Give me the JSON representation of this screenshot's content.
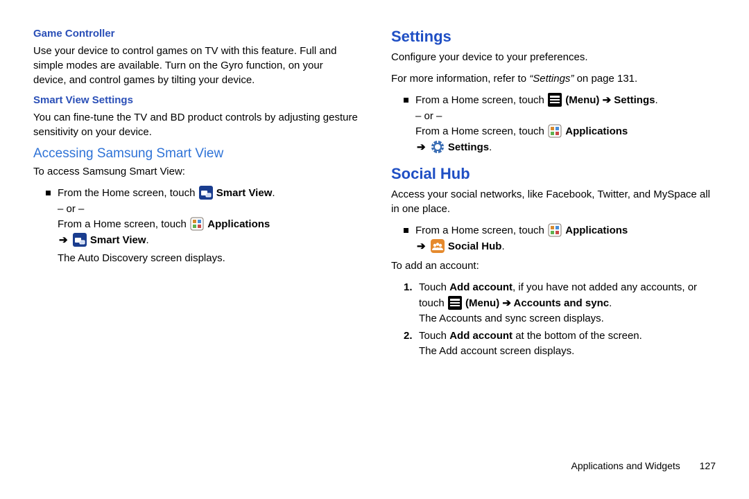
{
  "left": {
    "game_controller": {
      "title": "Game Controller",
      "body": "Use your device to control games on TV with this feature. Full and simple modes are available. Turn on the Gyro function, on your device, and control games by tilting your device."
    },
    "smart_view_settings": {
      "title": "Smart View Settings",
      "body": "You can fine-tune the TV and BD product controls by adjusting gesture sensitivity on your device."
    },
    "access": {
      "title": "Accessing Samsung Smart View",
      "intro": "To access Samsung Smart View:",
      "step1a": "From the Home screen, touch ",
      "smartview1": "Smart View",
      "or": "– or –",
      "step1b": "From a Home screen, touch ",
      "applications": "Applications",
      "smartview2": "Smart View",
      "after": "The Auto Discovery screen displays."
    }
  },
  "right": {
    "settings": {
      "title": "Settings",
      "p1": "Configure your device to your preferences.",
      "p2a": "For more information, refer to ",
      "p2q": "“Settings” ",
      "p2b": "on page 131.",
      "s1": "From a Home screen, touch ",
      "menu_settings": "(Menu) ➔ Settings",
      "or": "– or –",
      "s2": "From a Home screen, touch ",
      "applications": "Applications",
      "settings_label": "Settings"
    },
    "social": {
      "title": "Social Hub",
      "body": "Access your social networks, like Facebook, Twitter, and MySpace all in one place.",
      "s1": "From a Home screen, touch ",
      "applications": "Applications",
      "social_hub": "Social Hub",
      "add_intro": "To add an account:",
      "n1a": "Touch ",
      "n1b": "Add account",
      "n1c": ", if you have not added any accounts, or touch ",
      "menu_accounts": "(Menu) ➔ Accounts and sync",
      "n1after": "The Accounts and sync screen displays.",
      "n2a": "Touch ",
      "n2b": "Add account",
      "n2c": " at the bottom of the screen.",
      "n2after": "The Add account screen displays."
    }
  },
  "footer": {
    "section": "Applications and Widgets",
    "page": "127"
  }
}
